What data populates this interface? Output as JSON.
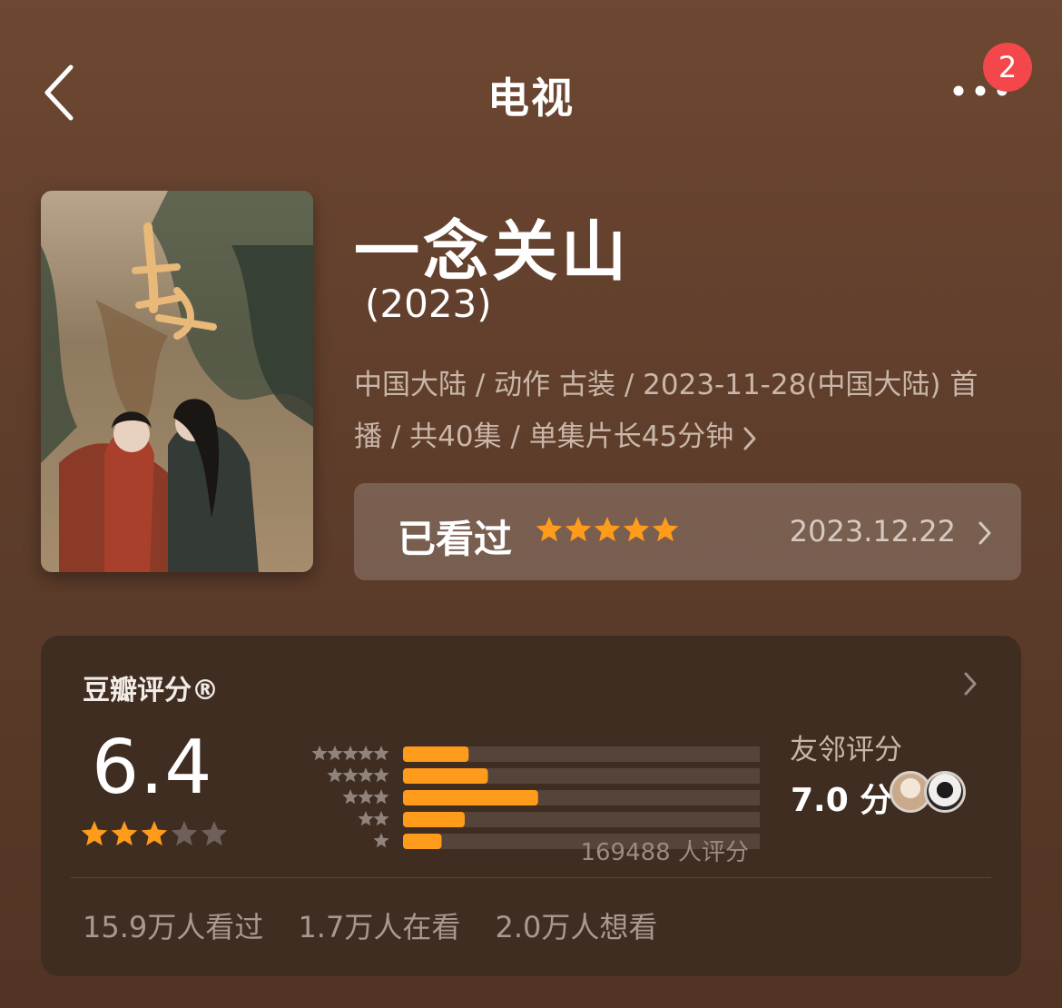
{
  "nav": {
    "title": "电视",
    "badge_count": "2"
  },
  "show": {
    "title": "一念关山",
    "year": "(2023)",
    "meta_line1": "中国大陆 / 动作 古装 / 2023-11-28(中国大陆) 首",
    "meta_line2": "播 / 共40集 / 单集片长45分钟"
  },
  "watched": {
    "label": "已看过",
    "my_rating": 5,
    "date": "2023.12.22"
  },
  "douban": {
    "title": "豆瓣评分®",
    "score": "6.4",
    "score_stars": 3,
    "histogram_percent": [
      17,
      22,
      35,
      16,
      10
    ],
    "total_ratings": "169488 人评分",
    "friend_label": "友邻评分",
    "friend_score": "7.0 分",
    "stats": [
      "15.9万人看过",
      "1.7万人在看",
      "2.0万人想看"
    ]
  },
  "colors": {
    "accent_orange": "#ff9b1a",
    "badge_red": "#f4474c"
  }
}
